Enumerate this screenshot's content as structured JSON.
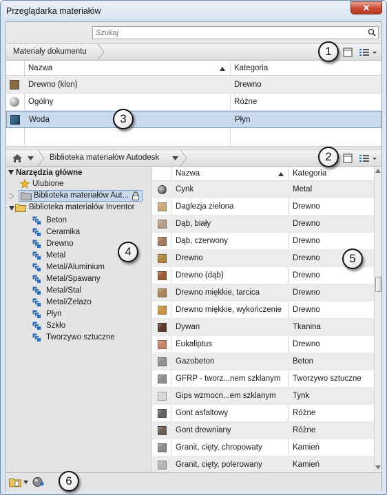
{
  "window": {
    "title": "Przeglądarka materiałów",
    "close": "✕"
  },
  "search": {
    "placeholder": "Szukaj"
  },
  "doc": {
    "breadcrumb": "Materiały dokumentu",
    "col_name": "Nazwa",
    "col_category": "Kategoria",
    "rows": [
      {
        "name": "Drewno (klon)",
        "category": "Drewno",
        "swatch": "#8a6a44"
      },
      {
        "name": "Ogólny",
        "category": "Różne",
        "swatch": "#bdbdbd"
      },
      {
        "name": "Woda",
        "category": "Płyn",
        "swatch": "#2e5675",
        "selected": true
      }
    ]
  },
  "library": {
    "breadcrumb": "Biblioteka materiałów Autodesk",
    "col_name": "Nazwa",
    "col_category": "Kategoria",
    "rows": [
      {
        "name": "Cynk",
        "category": "Metal",
        "swatch": "#555555"
      },
      {
        "name": "Daglezja zielona",
        "category": "Drewno",
        "swatch": "#c9a878"
      },
      {
        "name": "Dąb, biały",
        "category": "Drewno",
        "swatch": "#b79c86"
      },
      {
        "name": "Dąb, czerwony",
        "category": "Drewno",
        "swatch": "#a37a5a"
      },
      {
        "name": "Drewno",
        "category": "Drewno",
        "swatch": "#b0853f"
      },
      {
        "name": "Drewno (dąb)",
        "category": "Drewno",
        "swatch": "#9c5b35"
      },
      {
        "name": "Drewno miękkie, tarcica",
        "category": "Drewno",
        "swatch": "#a98655"
      },
      {
        "name": "Drewno miękkie, wykończenie",
        "category": "Drewno",
        "swatch": "#c99540"
      },
      {
        "name": "Dywan",
        "category": "Tkanina",
        "swatch": "#5b3a2c"
      },
      {
        "name": "Eukaliptus",
        "category": "Drewno",
        "swatch": "#c78363"
      },
      {
        "name": "Gazobeton",
        "category": "Beton",
        "swatch": "#909090"
      },
      {
        "name": "GFRP - tworz...nem szklanym",
        "category": "Tworzywo sztuczne",
        "swatch": "#8d8d8d"
      },
      {
        "name": "Gips wzmocn...em szklanym",
        "category": "Tynk",
        "swatch": "#d8d8d8"
      },
      {
        "name": "Gont asfaltowy",
        "category": "Różne",
        "swatch": "#616161"
      },
      {
        "name": "Gont drewniany",
        "category": "Różne",
        "swatch": "#6e5d52"
      },
      {
        "name": "Granit, cięty, chropowaty",
        "category": "Kamień",
        "swatch": "#8a8a8a"
      },
      {
        "name": "Granit, cięty, polerowany",
        "category": "Kamień",
        "swatch": "#b5b5b5"
      }
    ]
  },
  "tree": {
    "root": "Narzędzia główne",
    "favorites": "Ulubione",
    "autodesk": "Biblioteka materiałów Aut...",
    "inventor": "Biblioteka materiałów Inventor",
    "categories": [
      "Beton",
      "Ceramika",
      "Drewno",
      "Metal",
      "Metal/Aluminium",
      "Metal/Spawany",
      "Metal/Stal",
      "Metal/Żelazo",
      "Płyn",
      "Szkło",
      "Tworzywo sztuczne"
    ]
  },
  "callouts": [
    "1",
    "2",
    "3",
    "4",
    "5",
    "6"
  ],
  "colors": {
    "selection": "#c9d9ee",
    "selection_border": "#7da2ce",
    "folder": "#e8c35a",
    "cat_icon": "#2f6fbd",
    "star": "#f0b21e"
  }
}
